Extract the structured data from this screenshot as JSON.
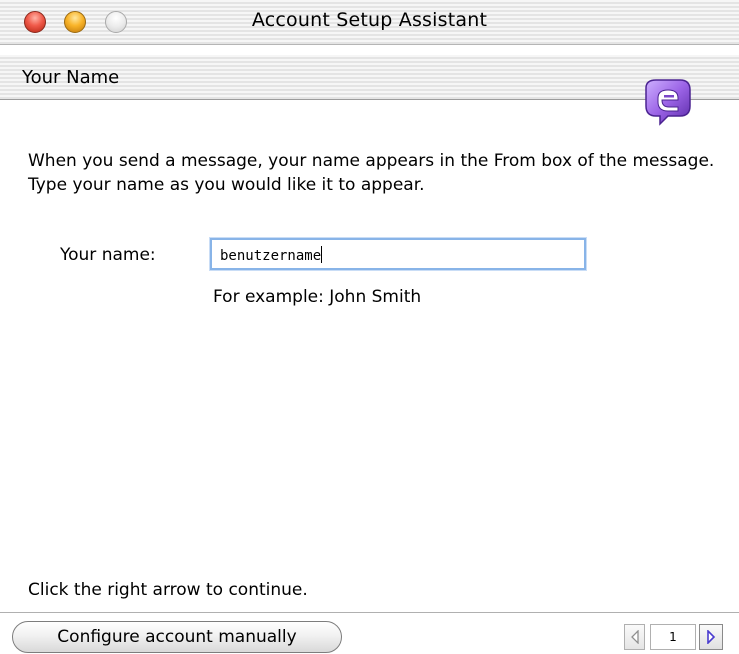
{
  "window": {
    "title": "Account Setup Assistant"
  },
  "header": {
    "section_title": "Your Name",
    "logo_icon": "entourage-logo-icon"
  },
  "main": {
    "description": "When you send a message, your name appears in the From box of the message. Type your name as you would like it to appear.",
    "name_field": {
      "label": "Your name:",
      "value": "benutzername"
    },
    "example": "For example: John Smith",
    "instruction": "Click the right arrow to continue."
  },
  "footer": {
    "configure_button": "Configure account manually",
    "pager": {
      "page": "1",
      "prev_icon": "left-arrow-icon",
      "next_icon": "right-arrow-icon"
    }
  },
  "colors": {
    "input_focus": "#88b4e8",
    "close": "#f05a4a",
    "minimize": "#f9b429",
    "logo": "#8e55d8",
    "next_arrow": "#4a3ccf"
  }
}
